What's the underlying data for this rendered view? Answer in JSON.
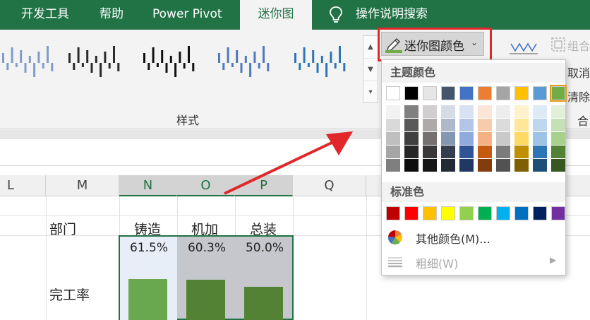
{
  "tabs": [
    {
      "label": "开发工具",
      "active": false
    },
    {
      "label": "帮助",
      "active": false
    },
    {
      "label": "Power Pivot",
      "active": false
    },
    {
      "label": "迷你图",
      "active": true
    },
    {
      "label": "操作说明搜索",
      "active": false
    }
  ],
  "ribbon": {
    "style_group_label": "样式",
    "sparkline_color_button": "迷你图颜色",
    "right_tools": {
      "group_label": "组合",
      "ungroup_label": "取消",
      "clear_label": "清除",
      "combo_label": "合"
    }
  },
  "style_gallery": [
    {
      "color": "#7f9ccb"
    },
    {
      "color": "#2b2b2b"
    },
    {
      "color": "#111111"
    },
    {
      "color": "#4f79bd"
    },
    {
      "color": "#2e75b6"
    }
  ],
  "color_panel": {
    "theme_heading": "主题颜色",
    "standard_heading": "标准色",
    "more_colors_label": "其他颜色(M)...",
    "weight_label": "粗细(W)",
    "theme_colors": [
      "#ffffff",
      "#000000",
      "#e7e6e6",
      "#44546a",
      "#4472c4",
      "#ed7d31",
      "#a5a5a5",
      "#ffc000",
      "#5b9bd5",
      "#70ad47"
    ],
    "theme_shades": [
      [
        "#f2f2f2",
        "#d9d9d9",
        "#bfbfbf",
        "#a6a6a6",
        "#7f7f7f"
      ],
      [
        "#808080",
        "#595959",
        "#404040",
        "#262626",
        "#0d0d0d"
      ],
      [
        "#d0cece",
        "#aeaaaa",
        "#757171",
        "#3a3838",
        "#171616"
      ],
      [
        "#d6dce4",
        "#adb9ca",
        "#8497b0",
        "#333f4f",
        "#222a35"
      ],
      [
        "#d9e2f3",
        "#b4c6e7",
        "#8faadc",
        "#2f5496",
        "#1f3864"
      ],
      [
        "#fbe5d6",
        "#f8cbad",
        "#f4b183",
        "#c55a11",
        "#833c0b"
      ],
      [
        "#ededed",
        "#dbdbdb",
        "#c9c9c9",
        "#7b7b7b",
        "#525252"
      ],
      [
        "#fff2cc",
        "#ffe699",
        "#ffd966",
        "#bf8f00",
        "#7f6000"
      ],
      [
        "#deebf7",
        "#bdd7ee",
        "#9dc3e6",
        "#2e75b6",
        "#1f4e79"
      ],
      [
        "#e2f0d9",
        "#c5e0b4",
        "#a9d18e",
        "#548235",
        "#385723"
      ]
    ],
    "standard_colors": [
      "#c00000",
      "#ff0000",
      "#ffc000",
      "#ffff00",
      "#92d050",
      "#00b050",
      "#00b0f0",
      "#0070c0",
      "#002060",
      "#7030a0"
    ],
    "selected_index": 9
  },
  "sheet": {
    "columns": [
      "L",
      "M",
      "N",
      "O",
      "P",
      "Q"
    ],
    "row_dept_label": "部门",
    "departments": [
      "铸造",
      "机加",
      "总装"
    ],
    "row_rate_label": "完工率",
    "rates": [
      "61.5%",
      "60.3%",
      "50.0%"
    ],
    "rate_values": [
      61.5,
      60.3,
      50.0
    ],
    "bar_colors": [
      "#6aa84f",
      "#548235",
      "#548235"
    ]
  }
}
